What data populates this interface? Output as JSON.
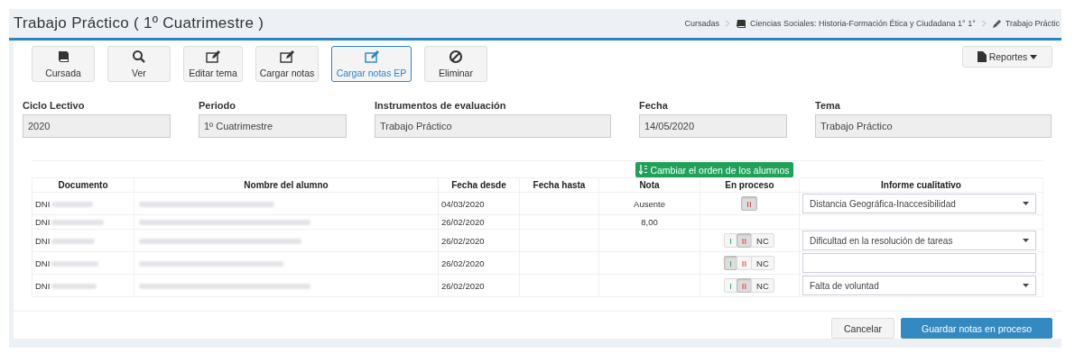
{
  "page": {
    "title": "Trabajo Práctico ( 1º Cuatrimestre )"
  },
  "breadcrumb": [
    {
      "label": "Cursadas"
    },
    {
      "label": "Ciencias Sociales: Historia-Formación Ética y Ciudadana 1° 1°"
    },
    {
      "label": "Trabajo Práctic"
    }
  ],
  "toolbar": [
    {
      "label": "Cursada",
      "selected": false
    },
    {
      "label": "Ver",
      "selected": false
    },
    {
      "label": "Editar tema",
      "selected": false
    },
    {
      "label": "Cargar notas",
      "selected": false
    },
    {
      "label": "Cargar notas EP",
      "selected": true
    },
    {
      "label": "Eliminar",
      "selected": false
    }
  ],
  "reports_button": {
    "label": "Reportes"
  },
  "fields": [
    {
      "label": "Ciclo Lectivo",
      "value": "2020"
    },
    {
      "label": "Periodo",
      "value": "1º Cuatrimestre"
    },
    {
      "label": "Instrumentos de evaluación",
      "value": "Trabajo Práctico"
    },
    {
      "label": "Fecha",
      "value": "14/05/2020"
    },
    {
      "label": "Tema",
      "value": "Trabajo Práctico"
    }
  ],
  "reorder_button": {
    "label": "Cambiar el orden de los alumnos"
  },
  "table": {
    "columns": [
      "Documento",
      "Nombre del alumno",
      "Fecha desde",
      "Fecha hasta",
      "Nota",
      "En proceso",
      "Informe cualitativo"
    ],
    "rows": [
      {
        "document": "DNI",
        "from": "04/03/2020",
        "grade": "Ausente",
        "process": [
          {
            "label": "II",
            "selected": true
          }
        ],
        "report": {
          "kind": "select",
          "value": "Distancia Geográfica-Inaccesibilidad"
        }
      },
      {
        "document": "DNI",
        "from": "26/02/2020",
        "grade": "8,00"
      },
      {
        "document": "DNI",
        "from": "26/02/2020",
        "process": [
          {
            "label": "I",
            "selected": false
          },
          {
            "label": "II",
            "selected": true
          },
          {
            "label": "NC",
            "selected": false
          }
        ],
        "report": {
          "kind": "select",
          "value": "Dificultad en la resolución de tareas"
        }
      },
      {
        "document": "DNI",
        "from": "26/02/2020",
        "process": [
          {
            "label": "I",
            "selected": true
          },
          {
            "label": "II",
            "selected": false
          },
          {
            "label": "NC",
            "selected": false
          }
        ],
        "report": {
          "kind": "text"
        }
      },
      {
        "document": "DNI",
        "from": "26/02/2020",
        "process": [
          {
            "label": "I",
            "selected": false
          },
          {
            "label": "II",
            "selected": true
          },
          {
            "label": "NC",
            "selected": false
          }
        ],
        "report": {
          "kind": "select",
          "value": "Falta de voluntad"
        }
      }
    ]
  },
  "footer": [
    {
      "label": "Cancelar",
      "kind": "default"
    },
    {
      "label": "Guardar notas en proceso",
      "kind": "primary"
    }
  ]
}
